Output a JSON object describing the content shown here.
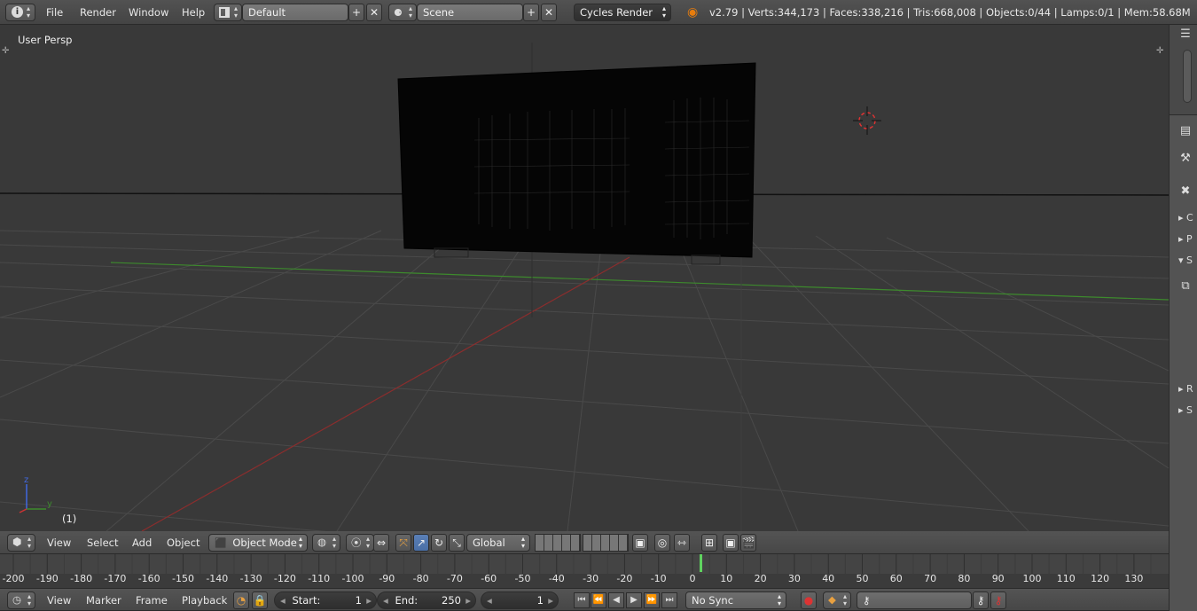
{
  "topbar": {
    "menus": [
      "File",
      "Render",
      "Window",
      "Help"
    ],
    "layout": "Default",
    "scene": "Scene",
    "engine": "Cycles Render",
    "stats": "v2.79 | Verts:344,173 | Faces:338,216 | Tris:668,008 | Objects:0/44 | Lamps:0/1 | Mem:58.68M"
  },
  "viewport": {
    "label": "User Persp",
    "frame_indicator": "(1)",
    "axis_labels": {
      "z": "z",
      "y": "y"
    }
  },
  "view3d_header": {
    "menus": [
      "View",
      "Select",
      "Add",
      "Object"
    ],
    "mode": "Object Mode",
    "orientation": "Global"
  },
  "timeline": {
    "ticks": [
      "-200",
      "-190",
      "-180",
      "-170",
      "-160",
      "-150",
      "-140",
      "-130",
      "-120",
      "-110",
      "-100",
      "-90",
      "-80",
      "-70",
      "-60",
      "-50",
      "-40",
      "-30",
      "-20",
      "-10",
      "0",
      "10",
      "20",
      "30",
      "40",
      "50",
      "60",
      "70",
      "80",
      "90",
      "100",
      "110",
      "120",
      "130"
    ],
    "current_frame_marker": 1
  },
  "timeline_header": {
    "menus": [
      "View",
      "Marker",
      "Frame",
      "Playback"
    ],
    "start_label": "Start:",
    "start_value": "1",
    "end_label": "End:",
    "end_value": "250",
    "current_frame": "1",
    "sync": "No Sync"
  },
  "right_panel": {
    "labels": [
      "C",
      "P",
      "S",
      "R",
      "S"
    ]
  },
  "colors": {
    "x_axis": "#8b2d2d",
    "y_axis": "#3d8a2d",
    "playhead": "#5fd35f"
  }
}
